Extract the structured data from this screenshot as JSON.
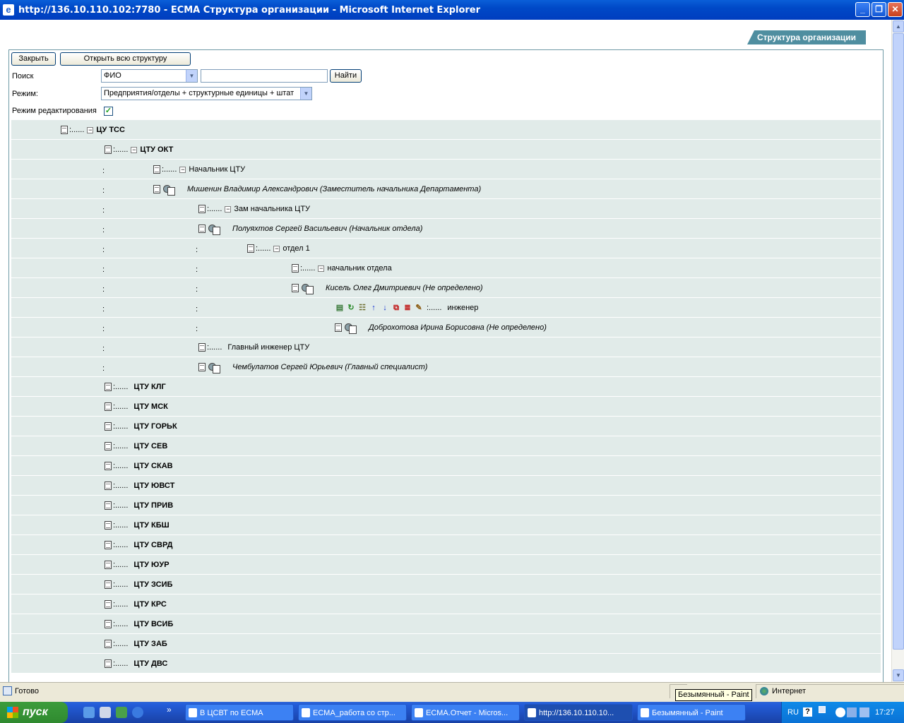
{
  "window": {
    "title": "http://136.10.110.102:7780 - ЕСМА Структура организации - Microsoft Internet Explorer",
    "min_label": "_",
    "max_label": "❐",
    "close_label": "✕"
  },
  "page": {
    "tab_title": "Структура организации",
    "buttons": {
      "close": "Закрыть",
      "open_all": "Открыть всю структуру",
      "find": "Найти"
    },
    "search": {
      "label": "Поиск",
      "field_value": "ФИО",
      "text_value": ""
    },
    "mode": {
      "label": "Режим:",
      "value": "Предприятия/отделы + структурные единицы + штат"
    },
    "edit_mode": {
      "label": "Режим редактирования",
      "checked": true,
      "check_glyph": "✓"
    }
  },
  "tree": [
    {
      "text": "ЦУ ТСС",
      "bold": true,
      "prefix": ":......",
      "expander": "⊟"
    },
    {
      "text": "ЦТУ ОКТ",
      "bold": true,
      "prefix": ":......",
      "expander": "⊟"
    },
    {
      "text": "Начальник ЦТУ",
      "prefix": ":......",
      "expander": "⊟",
      "colon": ":"
    },
    {
      "text": "Мишенин Владимир Александрович (Заместитель начальника Департамента)",
      "italic": true,
      "colon": ":"
    },
    {
      "text": "Зам начальника ЦТУ",
      "prefix": ":......",
      "expander": "⊟",
      "colon": ":"
    },
    {
      "text": "Полуяхтов Сергей Васильевич (Начальник отдела)",
      "italic": true,
      "colon": ":"
    },
    {
      "text": "отдел 1",
      "prefix": ":......",
      "expander": "⊟",
      "colon": ":",
      "colon2": ":"
    },
    {
      "text": "начальник отдела",
      "prefix": ":......",
      "expander": "⊟",
      "colon": ":",
      "colon2": ":"
    },
    {
      "text": "Кисель Олег Дмитриевич (Не определено)",
      "italic": true,
      "colon": ":",
      "colon2": ":"
    },
    {
      "text": "инженер",
      "prefix": ":......",
      "colon": ":",
      "colon2": ":",
      "toolbar": true
    },
    {
      "text": "Доброхотова Ирина Борисовна (Не определено)",
      "italic": true,
      "colon": ":",
      "colon2": ":"
    },
    {
      "text": "Главный инженер ЦТУ",
      "prefix": ":......",
      "colon": ":"
    },
    {
      "text": "Чембулатов Сергей Юрьевич (Главный специалист)",
      "italic": true,
      "colon": ":"
    },
    {
      "text": "ЦТУ КЛГ",
      "bold": true,
      "prefix": ":......"
    },
    {
      "text": "ЦТУ МСК",
      "bold": true,
      "prefix": ":......"
    },
    {
      "text": "ЦТУ ГОРЬК",
      "bold": true,
      "prefix": ":......"
    },
    {
      "text": "ЦТУ СЕВ",
      "bold": true,
      "prefix": ":......"
    },
    {
      "text": "ЦТУ СКАВ",
      "bold": true,
      "prefix": ":......"
    },
    {
      "text": "ЦТУ ЮВСТ",
      "bold": true,
      "prefix": ":......"
    },
    {
      "text": "ЦТУ ПРИВ",
      "bold": true,
      "prefix": ":......"
    },
    {
      "text": "ЦТУ КБШ",
      "bold": true,
      "prefix": ":......"
    },
    {
      "text": "ЦТУ СВРД",
      "bold": true,
      "prefix": ":......"
    },
    {
      "text": "ЦТУ ЮУР",
      "bold": true,
      "prefix": ":......"
    },
    {
      "text": "ЦТУ ЗСИБ",
      "bold": true,
      "prefix": ":......"
    },
    {
      "text": "ЦТУ КРС",
      "bold": true,
      "prefix": ":......"
    },
    {
      "text": "ЦТУ ВСИБ",
      "bold": true,
      "prefix": ":......"
    },
    {
      "text": "ЦТУ ЗАБ",
      "bold": true,
      "prefix": ":......"
    },
    {
      "text": "ЦТУ ДВС",
      "bold": true,
      "prefix": ":......"
    }
  ],
  "row_toolbar": [
    {
      "icon": "add-node-icon",
      "glyph": "▤",
      "color": "#3a7a3a"
    },
    {
      "icon": "refresh-icon",
      "glyph": "↻",
      "color": "#2a8a2a"
    },
    {
      "icon": "tree-icon",
      "glyph": "☷",
      "color": "#6a6a2a"
    },
    {
      "icon": "arrow-up-icon",
      "glyph": "↑",
      "color": "#1030d0"
    },
    {
      "icon": "arrow-down-icon",
      "glyph": "↓",
      "color": "#1030d0"
    },
    {
      "icon": "link-icon",
      "glyph": "⧉",
      "color": "#c01010"
    },
    {
      "icon": "list-delete-icon",
      "glyph": "≣",
      "color": "#c01010"
    },
    {
      "icon": "edit-icon",
      "glyph": "✎",
      "color": "#8a5a10"
    }
  ],
  "statusbar": {
    "status": "Готово",
    "zone": "Интернет",
    "tooltip": "Безымянный - Paint"
  },
  "taskbar": {
    "start": "пуск",
    "more": "»",
    "tasks": [
      {
        "label": "В ЦСВТ по ЕСМА",
        "icon": "folder-icon",
        "active": false
      },
      {
        "label": "ЕСМА_работа со стр...",
        "icon": "word-icon",
        "active": false
      },
      {
        "label": "ЕСМА.Отчет - Micros...",
        "icon": "word-icon",
        "active": false
      },
      {
        "label": "http://136.10.110.10...",
        "icon": "ie-icon",
        "active": true
      },
      {
        "label": "Безымянный - Paint",
        "icon": "paint-icon",
        "active": false
      }
    ],
    "lang": "RU",
    "help": "?",
    "time": "17:27"
  }
}
